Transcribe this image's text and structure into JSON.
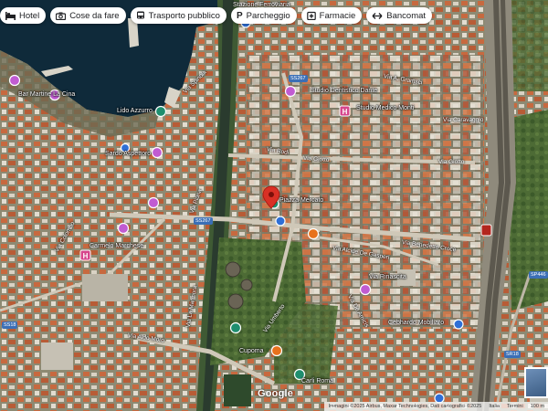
{
  "chips": [
    {
      "label": "Hotel",
      "icon": "bed-icon"
    },
    {
      "label": "Cose da fare",
      "icon": "camera-icon"
    },
    {
      "label": "Trasporto pubblico",
      "icon": "bus-icon"
    },
    {
      "label": "Parcheggio",
      "icon": "parking-icon"
    },
    {
      "label": "Farmacie",
      "icon": "pharmacy-icon"
    },
    {
      "label": "Bancomat",
      "icon": "atm-icon"
    }
  ],
  "places": {
    "lido": "Lido Azzurro",
    "sardo": "Sardo Aspettoro",
    "liberta": "Bar Martine La Cina",
    "medico": "Studio Medico Monti",
    "dentista": "Studio Dentistico Dante",
    "stazione": "Stazione Ferroviaria",
    "carmelo": "Carmelo Marchese",
    "central": "Piazza Mercato",
    "cupoma": "Cupoma",
    "cebhardo": "Cebhardo Mobiliaro",
    "rinascita": "Via Rinascita",
    "eurospin": "Carli Roma"
  },
  "roads": {
    "caravaggio": "Via Caravaggio",
    "giotto": "Via Giotto",
    "giotto2": "Via Giotto",
    "benedetto": "Via Benedetto Croce",
    "degasperi": "Via Alcide De Gasperi",
    "moro": "Via Aldo Moro",
    "spinola": "Via Spinola",
    "rodi": "Via Rodi",
    "colombo": "Via Colombo",
    "piana": "Via Piana",
    "umberto": "Via Umberto",
    "deamicis": "Via De Amicis",
    "lamarmora": "Via La Marmora",
    "gramsci": "Via A. Gramsci"
  },
  "shields": {
    "ss267": "SS267",
    "ss18": "SS18",
    "sr": "SR18",
    "sr2": "SS267",
    "sp": "SP446"
  },
  "footer": {
    "google": "Google",
    "attribution": "Immagini ©2025 Airbus, Maxar Technologies, Dati cartografici ©2025",
    "country": "Italia",
    "terms": "Termini",
    "scale": "100 m"
  },
  "colors": {
    "sea": "#0f2a3a",
    "roof": "#c7693f",
    "pin_red": "#d93025",
    "pink": "#c15bd2",
    "teal": "#1e8e6e",
    "blue": "#2f6fd6",
    "orange": "#e8711c",
    "hotel_pink": "#d6458c"
  }
}
